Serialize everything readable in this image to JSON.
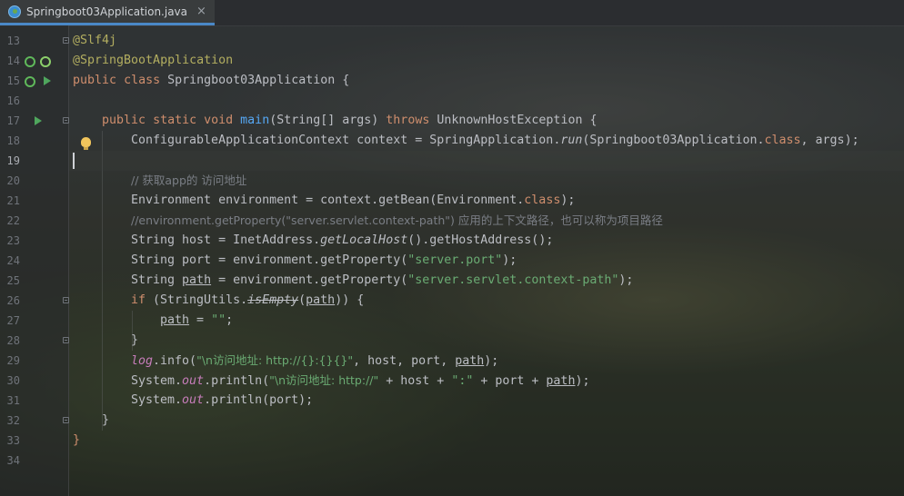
{
  "tab": {
    "filename": "Springboot03Application.java",
    "close": "×"
  },
  "lines": [
    {
      "n": "13"
    },
    {
      "n": "14"
    },
    {
      "n": "15"
    },
    {
      "n": "16"
    },
    {
      "n": "17"
    },
    {
      "n": "18"
    },
    {
      "n": "19"
    },
    {
      "n": "20"
    },
    {
      "n": "21"
    },
    {
      "n": "22"
    },
    {
      "n": "23"
    },
    {
      "n": "24"
    },
    {
      "n": "25"
    },
    {
      "n": "26"
    },
    {
      "n": "27"
    },
    {
      "n": "28"
    },
    {
      "n": "29"
    },
    {
      "n": "30"
    },
    {
      "n": "31"
    },
    {
      "n": "32"
    },
    {
      "n": "33"
    },
    {
      "n": "34"
    }
  ],
  "code": {
    "l13": {
      "ann": "@Slf4j"
    },
    "l14": {
      "ann": "@SpringBootApplication"
    },
    "l15": {
      "kw1": "public",
      "kw2": "class",
      "name": "Springboot03Application",
      "brace": " {"
    },
    "l17": {
      "kw1": "public",
      "kw2": "static",
      "kw3": "void",
      "fn": "main",
      "params": "(String[] args) ",
      "kw4": "throws",
      "exc": " UnknownHostException {"
    },
    "l18": {
      "a": "ConfigurableApplicationContext context = SpringApplication.",
      "fn": "run",
      "b": "(Springboot03Application.",
      "kw": "class",
      "c": ", args);"
    },
    "l20": {
      "cmt": "// 获取app的 访问地址"
    },
    "l21": {
      "a": "Environment environment = context.getBean(Environment.",
      "kw": "class",
      "b": ");"
    },
    "l22": {
      "cmt": "//environment.getProperty(\"server.servlet.context-path\") 应用的上下文路径，也可以称为项目路径"
    },
    "l23": {
      "a": "String host = InetAddress.",
      "fn": "getLocalHost",
      "b": "().getHostAddress();"
    },
    "l24": {
      "a": "String port = environment.getProperty(",
      "str": "\"server.port\"",
      "b": ");"
    },
    "l25": {
      "a": "String ",
      "var": "path",
      "b": " = environment.getProperty(",
      "str": "\"server.servlet.context-path\"",
      "c": ");"
    },
    "l26": {
      "kw": "if",
      "a": " (StringUtils.",
      "fn": "isEmpty",
      "b": "(",
      "var": "path",
      "c": ")) {"
    },
    "l27": {
      "var": "path",
      "a": " = ",
      "str": "\"\"",
      "b": ";"
    },
    "l28": {
      "a": "}"
    },
    "l29": {
      "fld": "log",
      "a": ".info(",
      "str": "\"\\n访问地址: http://{}:{}{}\"",
      "b": ", host, port, ",
      "var": "path",
      "c": ");"
    },
    "l30": {
      "a": "System.",
      "fld": "out",
      "b": ".println(",
      "str": "\"\\n访问地址: http://\"",
      "c": " + host + ",
      "str2": "\":\"",
      "d": " + port + ",
      "var": "path",
      "e": ");"
    },
    "l31": {
      "a": "System.",
      "fld": "out",
      "b": ".println(port);"
    },
    "l32": {
      "a": "}"
    },
    "l33": {
      "a": "}"
    }
  }
}
